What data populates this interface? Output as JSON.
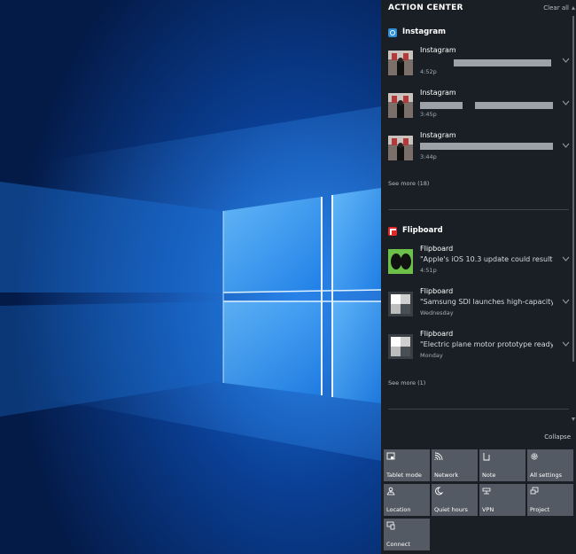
{
  "action_center": {
    "title": "ACTION CENTER",
    "clear_all": "Clear all",
    "collapse": "Collapse",
    "groups": [
      {
        "app": "Instagram",
        "notifications": [
          {
            "title": "Instagram",
            "body": "",
            "time": "4:52p"
          },
          {
            "title": "Instagram",
            "body": "",
            "time": "3:45p"
          },
          {
            "title": "Instagram",
            "body": "",
            "time": "3:44p"
          }
        ],
        "see_more": "See more (18)"
      },
      {
        "app": "Flipboard",
        "notifications": [
          {
            "title": "Flipboard",
            "body": "\"Apple's iOS 10.3 update could result i",
            "time": "4:51p"
          },
          {
            "title": "Flipboard",
            "body": "\"Samsung SDI launches high-capacity",
            "time": "Wednesday"
          },
          {
            "title": "Flipboard",
            "body": "\"Electric plane motor prototype ready",
            "time": "Monday"
          }
        ],
        "see_more": "See more (1)"
      }
    ],
    "quick_actions": [
      {
        "label": "Tablet mode",
        "icon": "tablet-mode-icon"
      },
      {
        "label": "Network",
        "icon": "network-icon"
      },
      {
        "label": "Note",
        "icon": "note-icon"
      },
      {
        "label": "All settings",
        "icon": "gear-icon"
      },
      {
        "label": "Location",
        "icon": "location-icon"
      },
      {
        "label": "Quiet hours",
        "icon": "moon-icon"
      },
      {
        "label": "VPN",
        "icon": "vpn-icon"
      },
      {
        "label": "Project",
        "icon": "project-icon"
      },
      {
        "label": "Connect",
        "icon": "connect-icon"
      }
    ]
  },
  "colors": {
    "desktop_background": "#072a6a",
    "panel_background": "#1a1f25",
    "tile_background": "#545a63",
    "instagram_icon": "#2f8fd6",
    "flipboard_icon": "#e12828"
  }
}
